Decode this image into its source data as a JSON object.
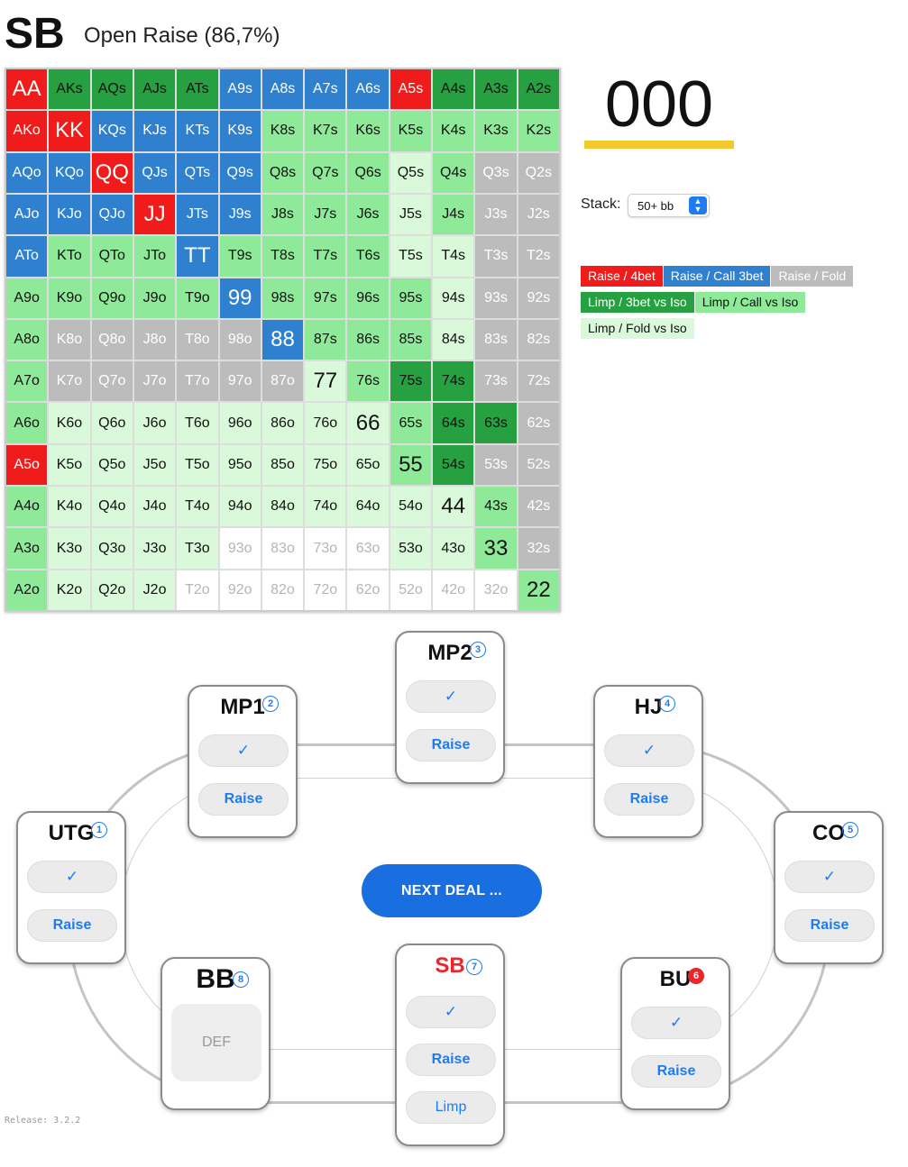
{
  "header": {
    "position": "SB",
    "action": "Open Raise (86,7%)"
  },
  "grid": {
    "rows": [
      [
        "AA",
        "AKs",
        "AQs",
        "AJs",
        "ATs",
        "A9s",
        "A8s",
        "A7s",
        "A6s",
        "A5s",
        "A4s",
        "A3s",
        "A2s"
      ],
      [
        "AKo",
        "KK",
        "KQs",
        "KJs",
        "KTs",
        "K9s",
        "K8s",
        "K7s",
        "K6s",
        "K5s",
        "K4s",
        "K3s",
        "K2s"
      ],
      [
        "AQo",
        "KQo",
        "QQ",
        "QJs",
        "QTs",
        "Q9s",
        "Q8s",
        "Q7s",
        "Q6s",
        "Q5s",
        "Q4s",
        "Q3s",
        "Q2s"
      ],
      [
        "AJo",
        "KJo",
        "QJo",
        "JJ",
        "JTs",
        "J9s",
        "J8s",
        "J7s",
        "J6s",
        "J5s",
        "J4s",
        "J3s",
        "J2s"
      ],
      [
        "ATo",
        "KTo",
        "QTo",
        "JTo",
        "TT",
        "T9s",
        "T8s",
        "T7s",
        "T6s",
        "T5s",
        "T4s",
        "T3s",
        "T2s"
      ],
      [
        "A9o",
        "K9o",
        "Q9o",
        "J9o",
        "T9o",
        "99",
        "98s",
        "97s",
        "96s",
        "95s",
        "94s",
        "93s",
        "92s"
      ],
      [
        "A8o",
        "K8o",
        "Q8o",
        "J8o",
        "T8o",
        "98o",
        "88",
        "87s",
        "86s",
        "85s",
        "84s",
        "83s",
        "82s"
      ],
      [
        "A7o",
        "K7o",
        "Q7o",
        "J7o",
        "T7o",
        "97o",
        "87o",
        "77",
        "76s",
        "75s",
        "74s",
        "73s",
        "72s"
      ],
      [
        "A6o",
        "K6o",
        "Q6o",
        "J6o",
        "T6o",
        "96o",
        "86o",
        "76o",
        "66",
        "65s",
        "64s",
        "63s",
        "62s"
      ],
      [
        "A5o",
        "K5o",
        "Q5o",
        "J5o",
        "T5o",
        "95o",
        "85o",
        "75o",
        "65o",
        "55",
        "54s",
        "53s",
        "52s"
      ],
      [
        "A4o",
        "K4o",
        "Q4o",
        "J4o",
        "T4o",
        "94o",
        "84o",
        "74o",
        "64o",
        "54o",
        "44",
        "43s",
        "42s"
      ],
      [
        "A3o",
        "K3o",
        "Q3o",
        "J3o",
        "T3o",
        "93o",
        "83o",
        "73o",
        "63o",
        "53o",
        "43o",
        "33",
        "32s"
      ],
      [
        "A2o",
        "K2o",
        "Q2o",
        "J2o",
        "T2o",
        "92o",
        "82o",
        "72o",
        "62o",
        "52o",
        "42o",
        "32o",
        "22"
      ]
    ],
    "colors": [
      "rddddbbbbrddd",
      "rrbbbbmmmmmmm",
      "bbrbbbmmmlmgg",
      "bbbrbbmmmlmgg",
      "bmmmbmmmmllgg",
      "mmmmmbmmmmlgg",
      "mgggggbmmmlgg",
      "mgggggglmddgg",
      "mllllllllmddgg",
      "rllllllllmdgg",
      "mllllllllllmgg",
      "mllllwwwwllmg",
      "mlllwwwwwwwwm"
    ],
    "palette": {
      "r": "#f01c1c",
      "b": "#2f80cf",
      "g": "#bcbcbc",
      "d": "#27a042",
      "m": "#8eea98",
      "l": "#daf8da",
      "w": "#ffffff"
    }
  },
  "counter": {
    "value": "000",
    "bar_color": "#f3c82d"
  },
  "stack": {
    "label": "Stack:",
    "selected": "50+ bb"
  },
  "legend": [
    {
      "label": "Raise / 4bet",
      "bg": "#f01c1c",
      "fg": "#ffffff"
    },
    {
      "label": "Raise / Call 3bet",
      "bg": "#2f80cf",
      "fg": "#ffffff"
    },
    {
      "label": "Raise / Fold",
      "bg": "#bcbcbc",
      "fg": "#ffffff"
    },
    {
      "label": "Limp / 3bet vs Iso",
      "bg": "#27a042",
      "fg": "#ffffff"
    },
    {
      "label": "Limp / Call vs Iso",
      "bg": "#8eea98",
      "fg": "#111111"
    },
    {
      "label": "Limp / Fold vs Iso",
      "bg": "#daf8da",
      "fg": "#111111"
    }
  ],
  "seats": {
    "utg": {
      "name": "UTG",
      "num": "1",
      "check": "✓",
      "raise": "Raise"
    },
    "mp1": {
      "name": "MP1",
      "num": "2",
      "check": "✓",
      "raise": "Raise"
    },
    "mp2": {
      "name": "MP2",
      "num": "3",
      "check": "✓",
      "raise": "Raise"
    },
    "hj": {
      "name": "HJ",
      "num": "4",
      "check": "✓",
      "raise": "Raise"
    },
    "co": {
      "name": "CO",
      "num": "5",
      "check": "✓",
      "raise": "Raise"
    },
    "bu": {
      "name": "BU",
      "num": "6",
      "check": "✓",
      "raise": "Raise"
    },
    "sb": {
      "name": "SB",
      "num": "7",
      "check": "✓",
      "raise": "Raise",
      "limp": "Limp"
    },
    "bb": {
      "name": "BB",
      "num": "8",
      "def": "DEF"
    }
  },
  "next_deal": "NEXT DEAL ...",
  "release": "Release: 3.2.2"
}
